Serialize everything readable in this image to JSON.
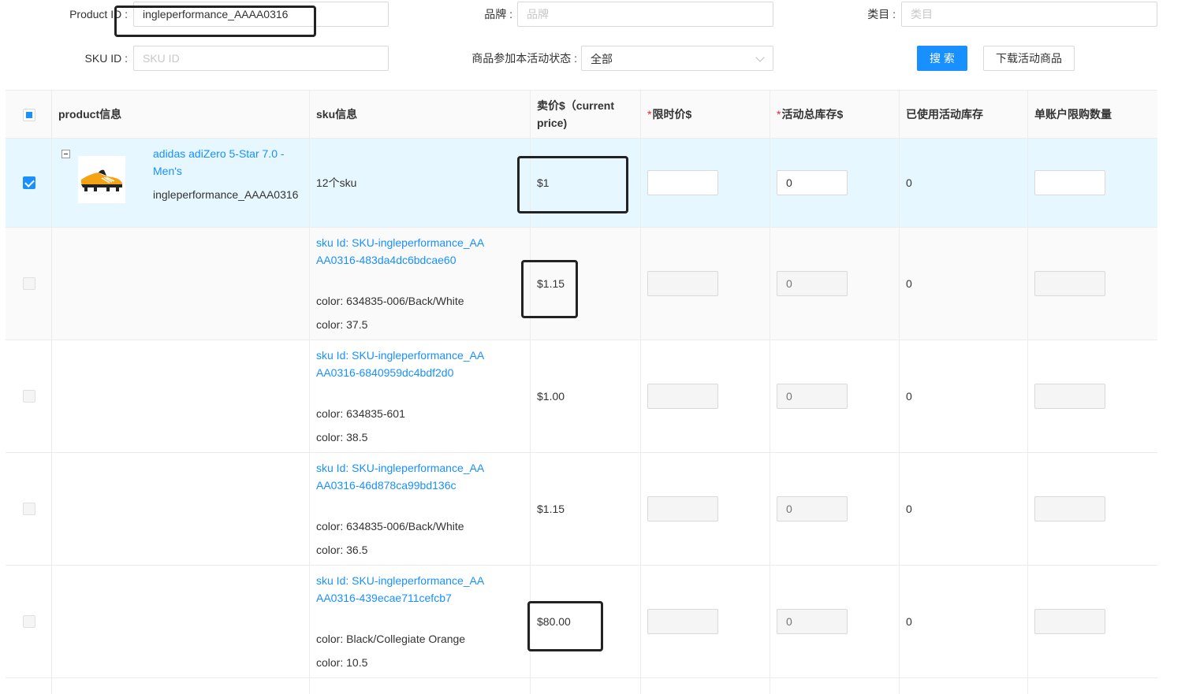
{
  "filters": {
    "product_id_label": "Product ID :",
    "product_id_value": "ingleperformance_AAAA0316",
    "brand_label": "品牌 :",
    "brand_placeholder": "品牌",
    "category_label": "类目 :",
    "category_placeholder": "类目",
    "sku_id_label": "SKU ID :",
    "sku_id_placeholder": "SKU ID",
    "status_label": "商品参加本活动状态 :",
    "status_value": "全部",
    "search_button": "搜 索",
    "download_button": "下载活动商品"
  },
  "table": {
    "headers": {
      "product": "product信息",
      "sku": "sku信息",
      "price": "卖价$（current price)",
      "limit_price": "限时价$",
      "total_stock": "活动总库存$",
      "used_stock": "已使用活动库存",
      "per_account": "单账户限购数量"
    },
    "product_row": {
      "title": "adidas adiZero 5-Star 7.0 - Men's",
      "product_id": "ingleperformance_AAAA0316",
      "sku_count": "12个sku",
      "price": "$1",
      "limit_price": "",
      "total_stock": "0",
      "used_stock": "0",
      "per_account": ""
    },
    "sku_rows": [
      {
        "sku_id": "sku Id: SKU-ingleperformance_AAAA0316-483da4dc6bdcae60",
        "color1": "color: 634835-006/Back/White",
        "color2": "color: 37.5",
        "price": "$1.15",
        "stock_placeholder": "0",
        "used": "0"
      },
      {
        "sku_id": "sku Id: SKU-ingleperformance_AAAA0316-6840959dc4bdf2d0",
        "color1": "color: 634835-601",
        "color2": "color: 38.5",
        "price": "$1.00",
        "stock_placeholder": "0",
        "used": "0"
      },
      {
        "sku_id": "sku Id: SKU-ingleperformance_AAAA0316-46d878ca99bd136c",
        "color1": "color: 634835-006/Back/White",
        "color2": "color: 36.5",
        "price": "$1.15",
        "stock_placeholder": "0",
        "used": "0"
      },
      {
        "sku_id": "sku Id: SKU-ingleperformance_AAAA0316-439ecae711cefcb7",
        "color1": "color: Black/Collegiate Orange",
        "color2": "color: 10.5",
        "price": "$80.00",
        "stock_placeholder": "0",
        "used": "0"
      }
    ]
  },
  "colors": {
    "primary": "#1890ff",
    "selected_row": "#e6f7ff",
    "required": "#f5222d"
  }
}
